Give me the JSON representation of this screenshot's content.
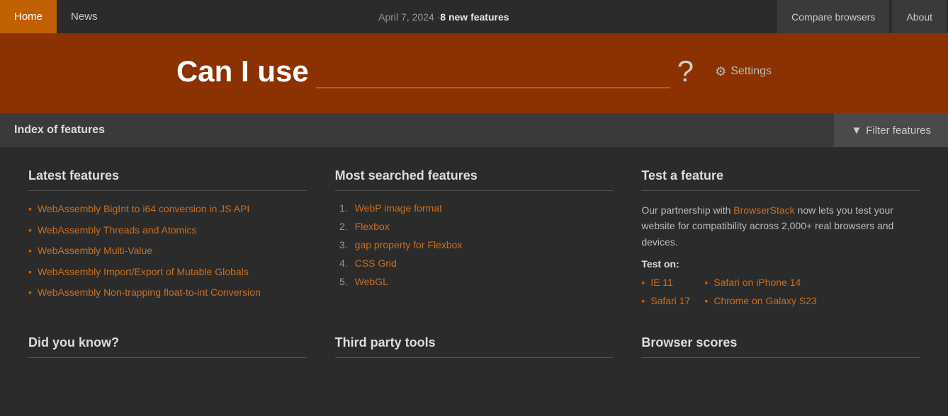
{
  "nav": {
    "home_label": "Home",
    "news_label": "News",
    "announcement": "April 7, 2024 · ",
    "announcement_highlight": "8 new features",
    "compare_label": "Compare browsers",
    "about_label": "About"
  },
  "hero": {
    "title": "Can I use",
    "question_mark": "?",
    "settings_label": "Settings",
    "input_placeholder": ""
  },
  "index_bar": {
    "label": "Index of features",
    "filter_label": "Filter features"
  },
  "latest_features": {
    "title": "Latest features",
    "items": [
      {
        "label": "WebAssembly BigInt to i64 conversion in JS API"
      },
      {
        "label": "WebAssembly Threads and Atomics"
      },
      {
        "label": "WebAssembly Multi-Value"
      },
      {
        "label": "WebAssembly Import/Export of Mutable Globals"
      },
      {
        "label": "WebAssembly Non-trapping float-to-int Conversion"
      }
    ]
  },
  "most_searched": {
    "title": "Most searched features",
    "items": [
      {
        "num": "1.",
        "label": "WebP image format"
      },
      {
        "num": "2.",
        "label": "Flexbox"
      },
      {
        "num": "3.",
        "label": "gap property for Flexbox"
      },
      {
        "num": "4.",
        "label": "CSS Grid"
      },
      {
        "num": "5.",
        "label": "WebGL"
      }
    ]
  },
  "test_feature": {
    "title": "Test a feature",
    "description_1": "Our partnership with ",
    "browserstack": "BrowserStack",
    "description_2": " now lets you test your website for compatibility across 2,000+ real browsers and devices.",
    "test_on_label": "Test on:",
    "browsers_col1": [
      {
        "label": "IE 11"
      },
      {
        "label": "Safari 17"
      }
    ],
    "browsers_col2": [
      {
        "label": "Safari on iPhone 14"
      },
      {
        "label": "Chrome on Galaxy S23"
      }
    ]
  },
  "did_you_know": {
    "title": "Did you know?"
  },
  "third_party": {
    "title": "Third party tools"
  },
  "browser_scores": {
    "title": "Browser scores"
  }
}
